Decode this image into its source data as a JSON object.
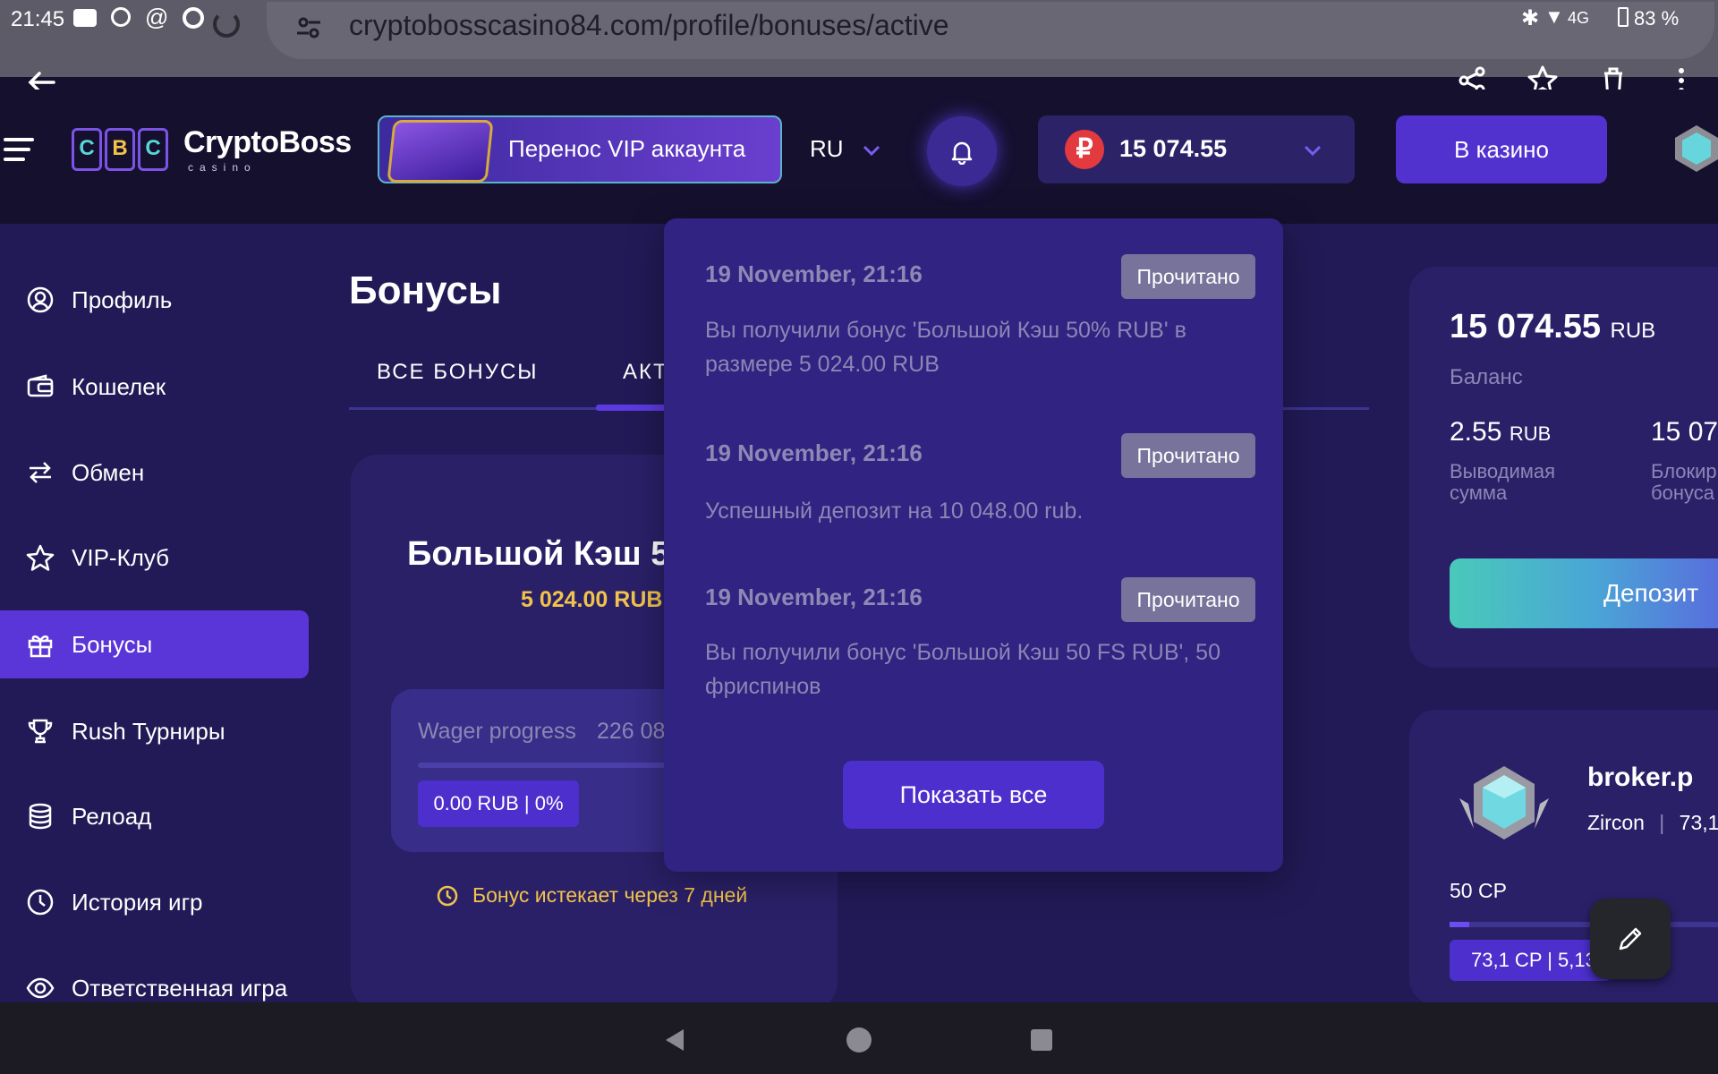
{
  "status": {
    "time": "21:45",
    "network": "4G",
    "battery": "83 %"
  },
  "browser": {
    "url": "cryptobosscasino84.com/profile/bonuses/active"
  },
  "header": {
    "logo_letters": [
      "C",
      "B",
      "C"
    ],
    "logo_title": "CryptoBoss",
    "logo_sub": "casino",
    "vip_transfer": "Перенос VIP аккаунта",
    "language": "RU",
    "balance": "15 074.55",
    "currency_symbol": "₽",
    "casino_button": "В казино"
  },
  "sidebar": {
    "items": [
      {
        "label": "Профиль",
        "icon": "profile-icon"
      },
      {
        "label": "Кошелек",
        "icon": "wallet-icon"
      },
      {
        "label": "Обмен",
        "icon": "exchange-icon"
      },
      {
        "label": "VIP-Клуб",
        "icon": "star-icon"
      },
      {
        "label": "Бонусы",
        "icon": "gift-icon",
        "active": true
      },
      {
        "label": "Rush Турниры",
        "icon": "trophy-icon"
      },
      {
        "label": "Релоад",
        "icon": "database-icon"
      },
      {
        "label": "История игр",
        "icon": "clock-icon"
      },
      {
        "label": "Ответственная игра",
        "icon": "eye-icon"
      }
    ]
  },
  "content": {
    "title": "Бонусы",
    "tabs": [
      "ВСЕ БОНУСЫ",
      "АКТ"
    ],
    "bonus_card": {
      "name": "Большой Кэш 5",
      "amount": "5 024.00 RUB",
      "wager_label": "Wager progress",
      "wager_value": "226 08",
      "wager_badge": "0.00 RUB | 0%",
      "wager_progress": 0,
      "expires": "Бонус истекает через 7 дней"
    }
  },
  "notifications": {
    "items": [
      {
        "date": "19 November, 21:16",
        "badge": "Прочитано",
        "message": "Вы получили бонус 'Большой Кэш 50% RUB' в размере 5 024.00 RUB"
      },
      {
        "date": "19 November, 21:16",
        "badge": "Прочитано",
        "message": "Успешный депозит на 10 048.00 rub."
      },
      {
        "date": "19 November, 21:16",
        "badge": "Прочитано",
        "message": "Вы получили бонус 'Большой Кэш 50 FS RUB', 50 фриспинов"
      }
    ],
    "show_all": "Показать все"
  },
  "balance_panel": {
    "amount": "15 074.55",
    "currency": "RUB",
    "label": "Баланс",
    "withdrawable_amount": "2.55",
    "withdrawable_currency": "RUB",
    "withdrawable_label_1": "Выводимая",
    "withdrawable_label_2": "сумма",
    "blocked_amount": "15 07",
    "blocked_label_1": "Блокир",
    "blocked_label_2": "бонуса",
    "deposit_button": "Депозит"
  },
  "vip_panel": {
    "username": "broker.p",
    "level": "Zircon",
    "points_partial": "73,1",
    "cp": "50 CP",
    "progress_text": "73,1 CP | 5,13"
  },
  "colors": {
    "accent": "#5a35d8",
    "gold": "#f2c34a",
    "background": "#211a56"
  }
}
